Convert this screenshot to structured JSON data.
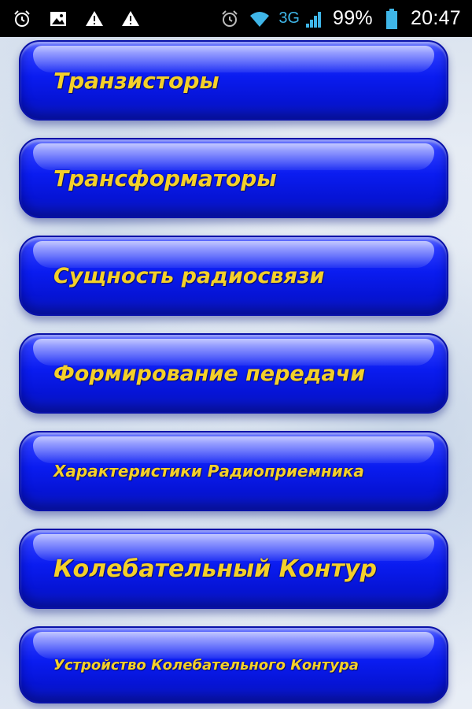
{
  "status_bar": {
    "left_icons": [
      "alarm-clock-icon",
      "image-icon",
      "warning-icon",
      "warning-icon"
    ],
    "right_icons": [
      "alarm-icon",
      "wifi-icon",
      "signal-icon",
      "battery-icon"
    ],
    "network": "3G",
    "battery": "99%",
    "time": "20:47",
    "colors": {
      "background": "#000000",
      "text": "#ffffff",
      "accent": "#3fb6e8"
    }
  },
  "menu": {
    "items": [
      {
        "label": "Транзисторы"
      },
      {
        "label": "Трансформаторы"
      },
      {
        "label": "Сущность радиосвязи"
      },
      {
        "label": "Формирование передачи"
      },
      {
        "label": "Характеристики Радиоприемника"
      },
      {
        "label": "Колебательный Контур"
      },
      {
        "label": "Устройство Колебательного Контура"
      }
    ],
    "colors": {
      "button": "#0a1cf0",
      "label": "#f4d02a"
    }
  }
}
